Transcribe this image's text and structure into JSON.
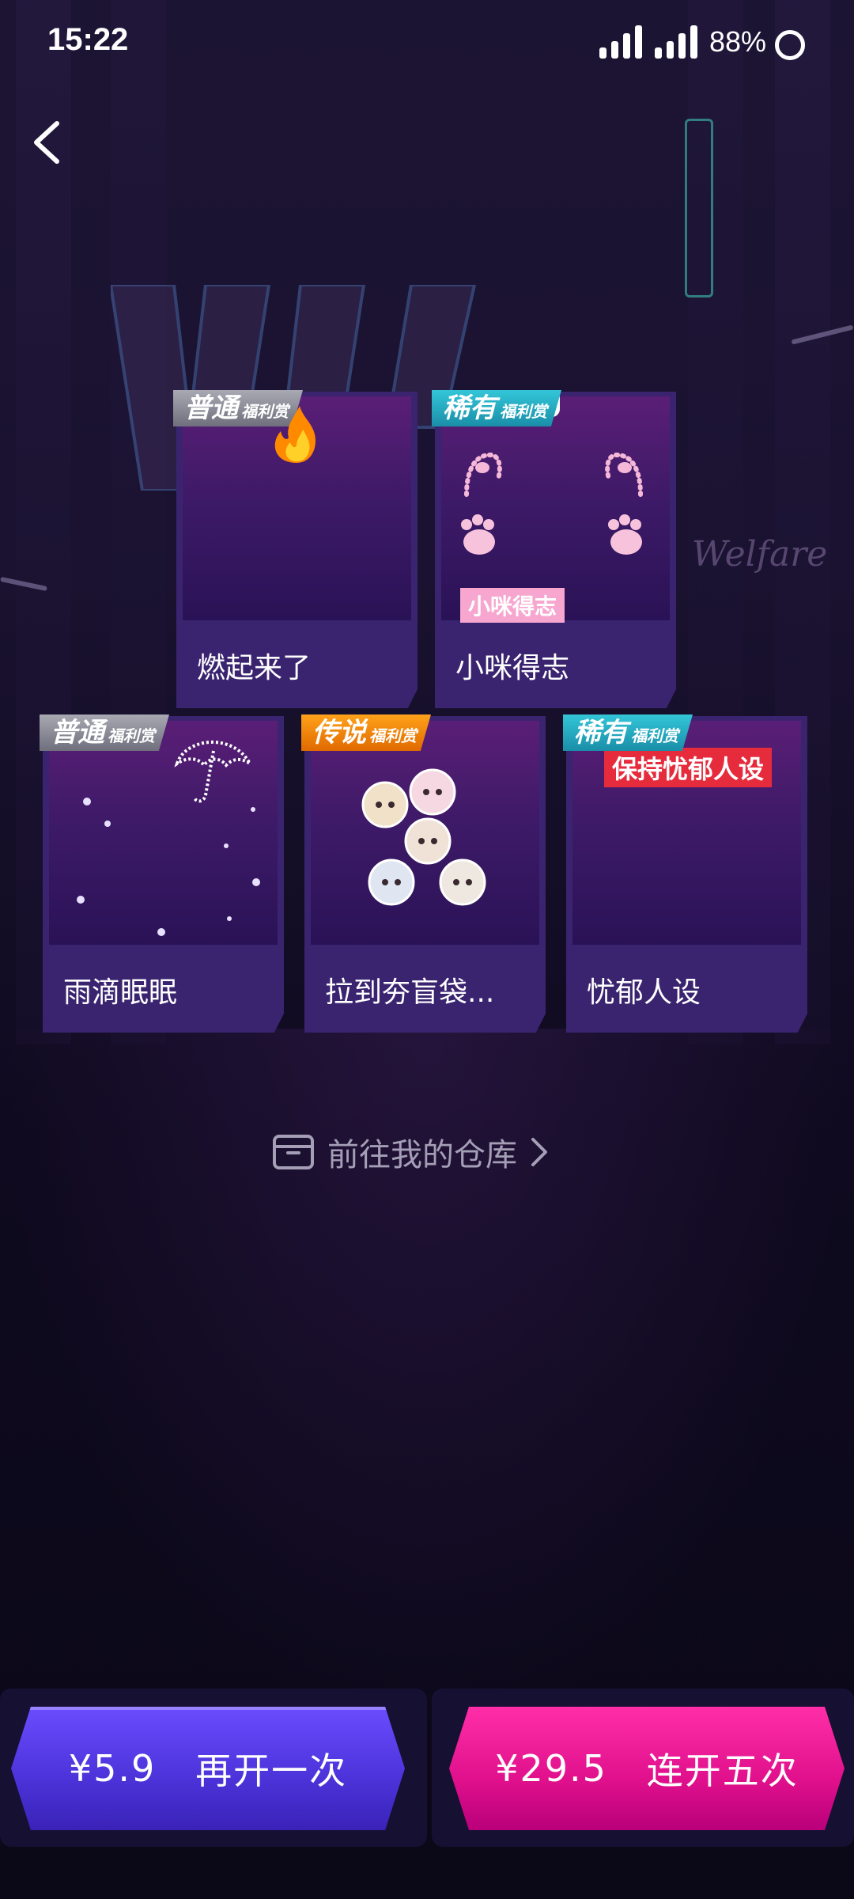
{
  "status_bar": {
    "time": "15:22",
    "battery_percent": "88%"
  },
  "background": {
    "logo_text": "Welfare"
  },
  "cards": [
    {
      "tier": "普通",
      "tier_suffix": "福利赏",
      "tier_color": "#8a8a96",
      "name": "燃起来了",
      "art": "fire-icon"
    },
    {
      "tier": "稀有",
      "tier_suffix": "福利赏",
      "tier_color": "#27aac0",
      "name": "小咪得志",
      "art": "cat-ears-frame",
      "overlay": "小咪得志",
      "bubble": "(··)"
    },
    {
      "tier": "普通",
      "tier_suffix": "福利赏",
      "tier_color": "#8a8a96",
      "name": "雨滴眠眠",
      "art": "umbrella-icon"
    },
    {
      "tier": "传说",
      "tier_suffix": "福利赏",
      "tier_color": "#f08a00",
      "name": "拉到夯盲袋...",
      "art": "badges-group"
    },
    {
      "tier": "稀有",
      "tier_suffix": "福利赏",
      "tier_color": "#27aac0",
      "name": "忧郁人设",
      "art": "text-sticker",
      "overlay": "保持忧郁人设"
    }
  ],
  "warehouse_link": "前往我的仓库",
  "buttons": {
    "open_again": {
      "price": "¥5.9",
      "label": "再开一次"
    },
    "open_five": {
      "price": "¥29.5",
      "label": "连开五次"
    }
  },
  "colors": {
    "primary_button": "#4a32d8",
    "secondary_button": "#e0108c"
  }
}
